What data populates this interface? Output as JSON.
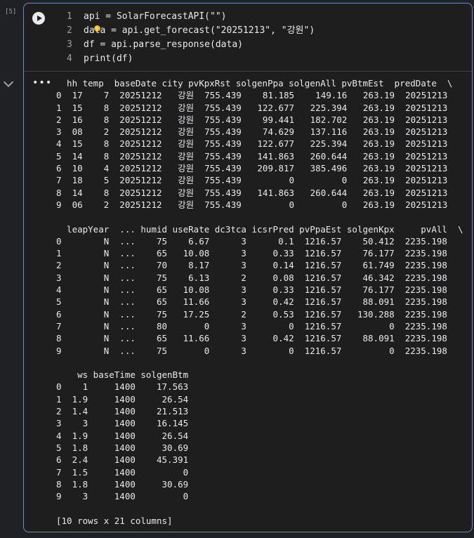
{
  "cell": {
    "execution_count": "[5]"
  },
  "code": {
    "lines": [
      {
        "n": "1",
        "text": "api = SolarForecastAPI(\"\")"
      },
      {
        "n": "2",
        "text": "data = api.get_forecast(\"20251213\", \"강원\")"
      },
      {
        "n": "3",
        "text": "df = api.parse_response(data)"
      },
      {
        "n": "4",
        "text": "print(df)"
      }
    ]
  },
  "output": {
    "lines": [
      "  hh temp  baseDate city pvKpxRst solgenPpa solgenAll pvBtmEst  predDate  \\",
      "0  17    7  20251212   강원  755.439    81.185    149.16   263.19  20251213",
      "1  15    8  20251212   강원  755.439   122.677   225.394   263.19  20251213",
      "2  16    8  20251212   강원  755.439    99.441   182.702   263.19  20251213",
      "3  08    2  20251212   강원  755.439    74.629   137.116   263.19  20251213",
      "4  15    8  20251212   강원  755.439   122.677   225.394   263.19  20251213",
      "5  14    8  20251212   강원  755.439   141.863   260.644   263.19  20251213",
      "6  10    4  20251212   강원  755.439   209.817   385.496   263.19  20251213",
      "7  18    5  20251212   강원  755.439         0         0   263.19  20251213",
      "8  14    8  20251212   강원  755.439   141.863   260.644   263.19  20251213",
      "9  06    2  20251212   강원  755.439         0         0   263.19  20251213",
      "",
      "  leapYear  ... humid useRate dc3tca icsrPred pvPpaEst solgenKpx     pvAll  \\",
      "0        N  ...    75    6.67      3      0.1  1216.57    50.412  2235.198",
      "1        N  ...    65   10.08      3     0.33  1216.57    76.177  2235.198",
      "2        N  ...    70    8.17      3     0.14  1216.57    61.749  2235.198",
      "3        N  ...    75    6.13      2     0.08  1216.57    46.342  2235.198",
      "4        N  ...    65   10.08      3     0.33  1216.57    76.177  2235.198",
      "5        N  ...    65   11.66      3     0.42  1216.57    88.091  2235.198",
      "6        N  ...    75   17.25      2     0.53  1216.57   130.288  2235.198",
      "7        N  ...    80       0      3        0  1216.57         0  2235.198",
      "8        N  ...    65   11.66      3     0.42  1216.57    88.091  2235.198",
      "9        N  ...    75       0      3        0  1216.57         0  2235.198",
      "",
      "    ws baseTime solgenBtm",
      "0    1     1400    17.563",
      "1  1.9     1400     26.54",
      "2  1.4     1400    21.513",
      "3    3     1400    16.145",
      "4  1.9     1400     26.54",
      "5  1.8     1400     30.69",
      "6  2.4     1400    45.391",
      "7  1.5     1400         0",
      "8  1.8     1400     30.69",
      "9    3     1400         0",
      "",
      "[10 rows x 21 columns]"
    ]
  }
}
